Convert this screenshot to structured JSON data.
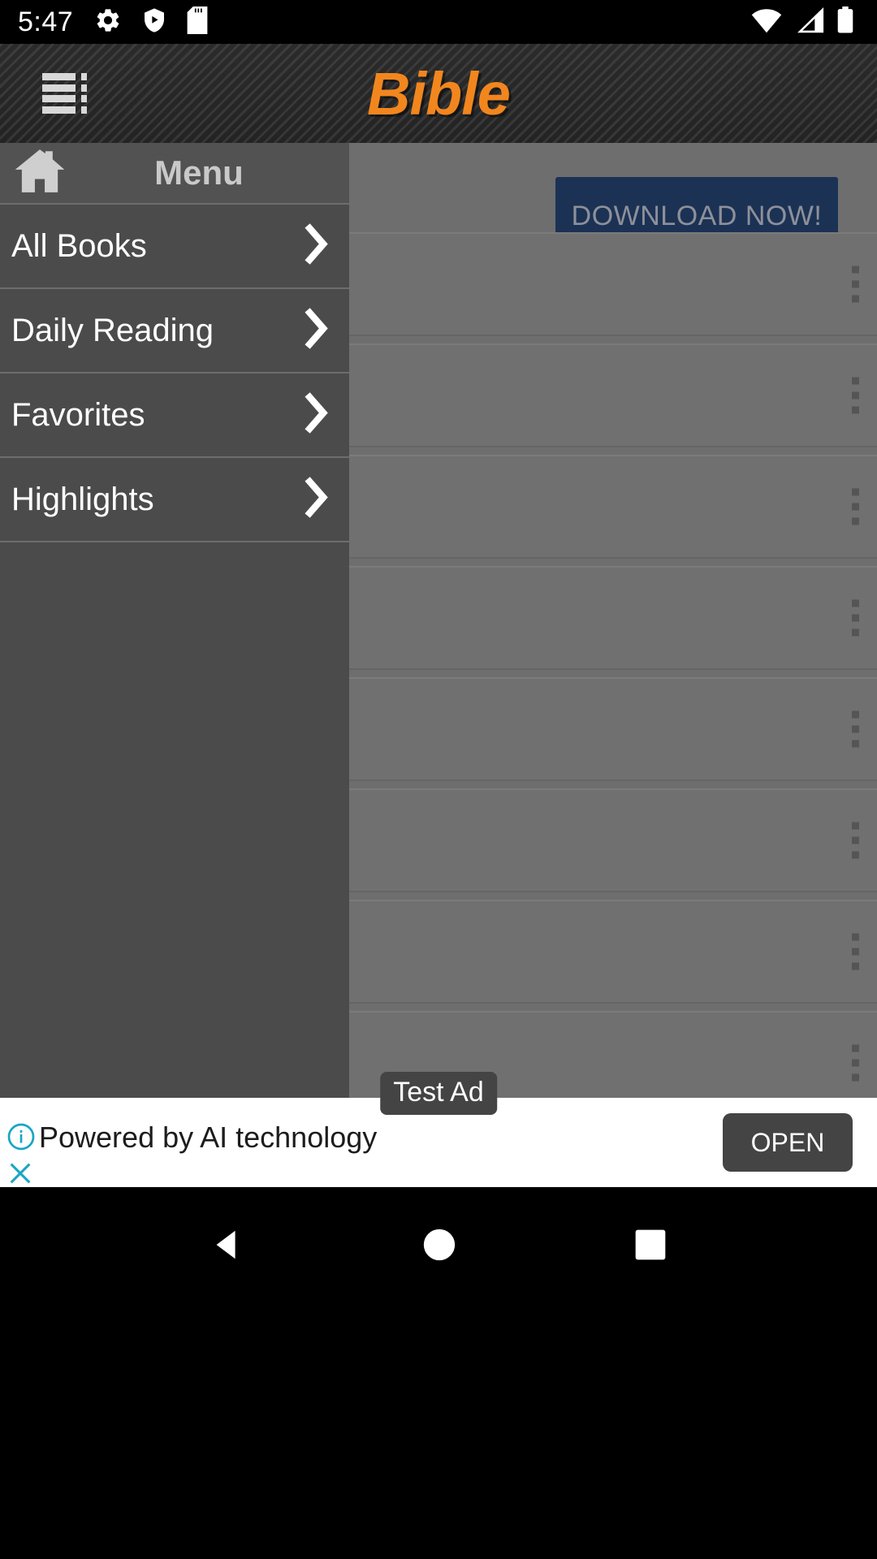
{
  "status_bar": {
    "time": "5:47",
    "left_icons": [
      "gear-icon",
      "play-protect-shield-icon",
      "sd-card-icon"
    ],
    "right_icons": [
      "wifi-icon",
      "cellular-signal-icon",
      "battery-icon"
    ]
  },
  "app_bar": {
    "menu_icon": "hamburger-menu-icon",
    "title": "Bible",
    "title_color": "#F2861E"
  },
  "drawer": {
    "home_icon": "home-icon",
    "title": "Menu",
    "items": [
      {
        "label": "All Books",
        "chevron": "chevron-right-icon"
      },
      {
        "label": "Daily Reading",
        "chevron": "chevron-right-icon"
      },
      {
        "label": "Favorites",
        "chevron": "chevron-right-icon"
      },
      {
        "label": "Highlights",
        "chevron": "chevron-right-icon"
      }
    ]
  },
  "content": {
    "teaser_fragment": ".",
    "download_button": "DOWNLOAD NOW!",
    "download_button_color": "#1b3255",
    "card_count": 8,
    "card_menu_icon": "kebab-menu-icon"
  },
  "ad": {
    "badge": "Test Ad",
    "info_icon": "info-icon",
    "text": "Powered by AI technology",
    "close_icon": "close-icon",
    "open_button": "OPEN",
    "accent_color": "#18a6c4"
  },
  "nav_bar": {
    "back": "back-triangle-icon",
    "home": "home-circle-icon",
    "recents": "recents-square-icon"
  }
}
